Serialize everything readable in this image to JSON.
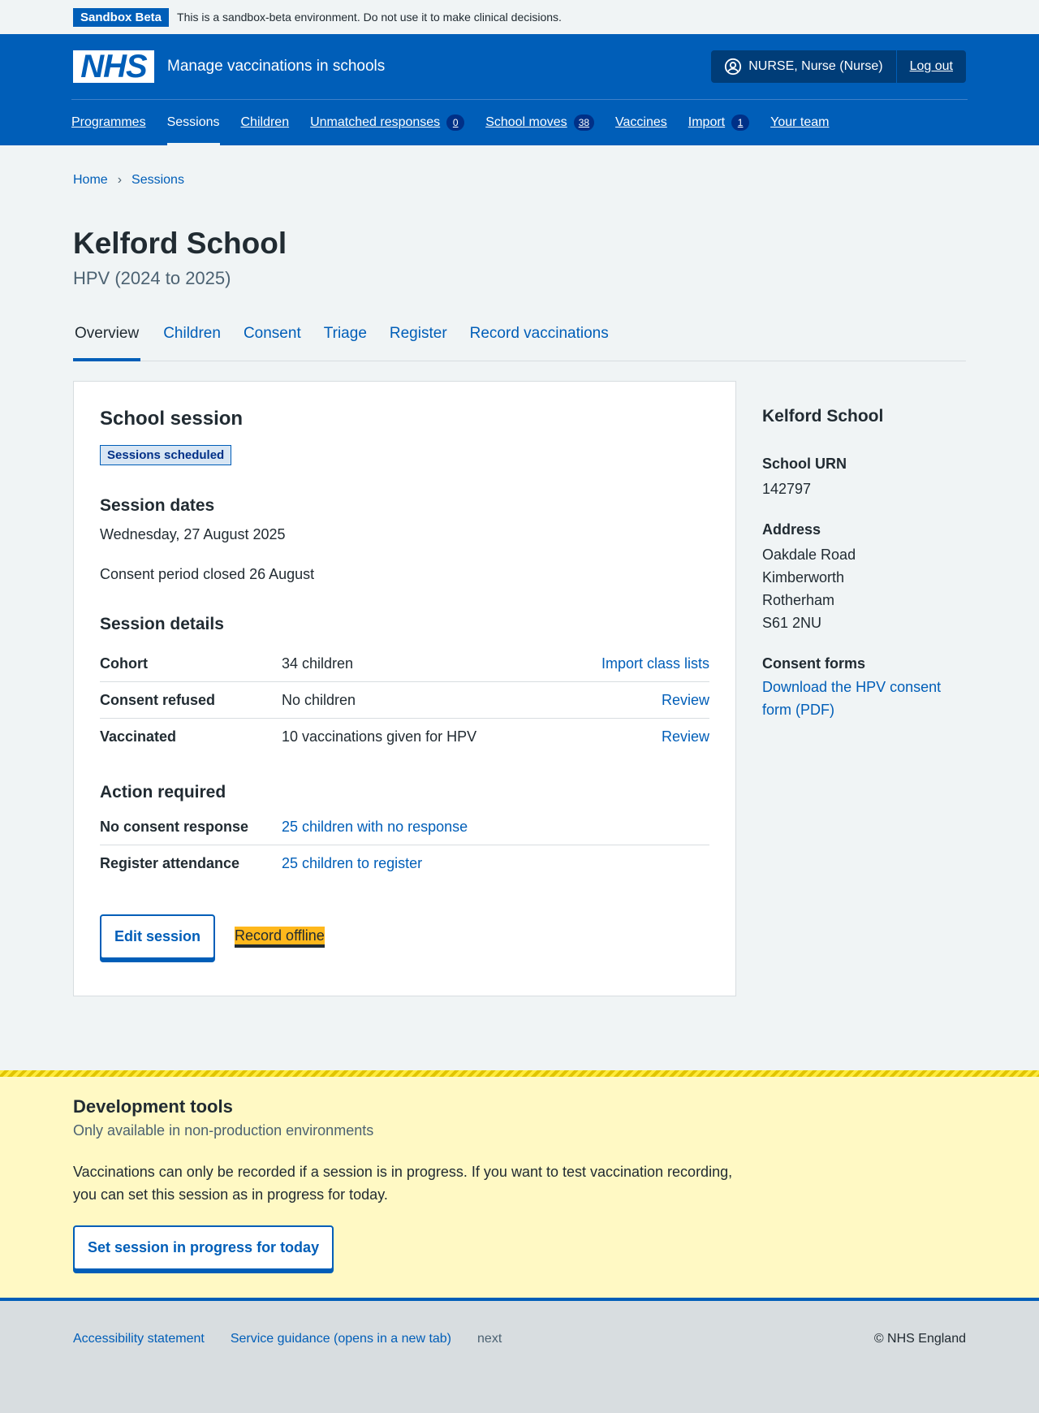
{
  "banner": {
    "tag": "Sandbox Beta",
    "text": "This is a sandbox-beta environment. Do not use it to make clinical decisions."
  },
  "header": {
    "logo": "NHS",
    "service_name": "Manage vaccinations in schools",
    "user": "NURSE, Nurse (Nurse)",
    "logout": "Log out",
    "nav": [
      {
        "label": "Programmes"
      },
      {
        "label": "Sessions",
        "active": true
      },
      {
        "label": "Children"
      },
      {
        "label": "Unmatched responses",
        "count": "0"
      },
      {
        "label": "School moves",
        "count": "38"
      },
      {
        "label": "Vaccines"
      },
      {
        "label": "Import",
        "count": "1"
      },
      {
        "label": "Your team"
      }
    ]
  },
  "breadcrumb": {
    "home": "Home",
    "sessions": "Sessions",
    "separator": "›"
  },
  "page": {
    "title": "Kelford School",
    "caption": "HPV (2024 to 2025)"
  },
  "tabs": [
    "Overview",
    "Children",
    "Consent",
    "Triage",
    "Register",
    "Record vaccinations"
  ],
  "card": {
    "title": "School session",
    "status": "Sessions scheduled",
    "dates_heading": "Session dates",
    "date": "Wednesday, 27 August 2025",
    "consent_period": "Consent period closed 26 August",
    "details_heading": "Session details",
    "details": [
      {
        "key": "Cohort",
        "value": "34 children",
        "action": "Import class lists"
      },
      {
        "key": "Consent refused",
        "value": "No children",
        "action": "Review"
      },
      {
        "key": "Vaccinated",
        "value": "10 vaccinations given for HPV",
        "action": "Review"
      }
    ],
    "action_heading": "Action required",
    "actions": [
      {
        "key": "No consent response",
        "link": "25 children with no response"
      },
      {
        "key": "Register attendance",
        "link": "25 children to register"
      }
    ],
    "edit_button": "Edit session",
    "record_offline": "Record offline"
  },
  "aside": {
    "school": "Kelford School",
    "urn_label": "School URN",
    "urn": "142797",
    "address_label": "Address",
    "address": [
      "Oakdale Road",
      "Kimberworth",
      "Rotherham",
      "S61 2NU"
    ],
    "forms_label": "Consent forms",
    "form_link": "Download the HPV consent form (PDF)"
  },
  "dev_tools": {
    "title": "Development tools",
    "subtitle": "Only available in non-production environments",
    "text": "Vaccinations can only be recorded if a session is in progress. If you want to test vaccination recording, you can set this session as in progress for today.",
    "button": "Set session in progress for today"
  },
  "footer": {
    "accessibility": "Accessibility statement",
    "guidance": "Service guidance (opens in a new tab)",
    "version": "next",
    "copyright": "© NHS England"
  }
}
